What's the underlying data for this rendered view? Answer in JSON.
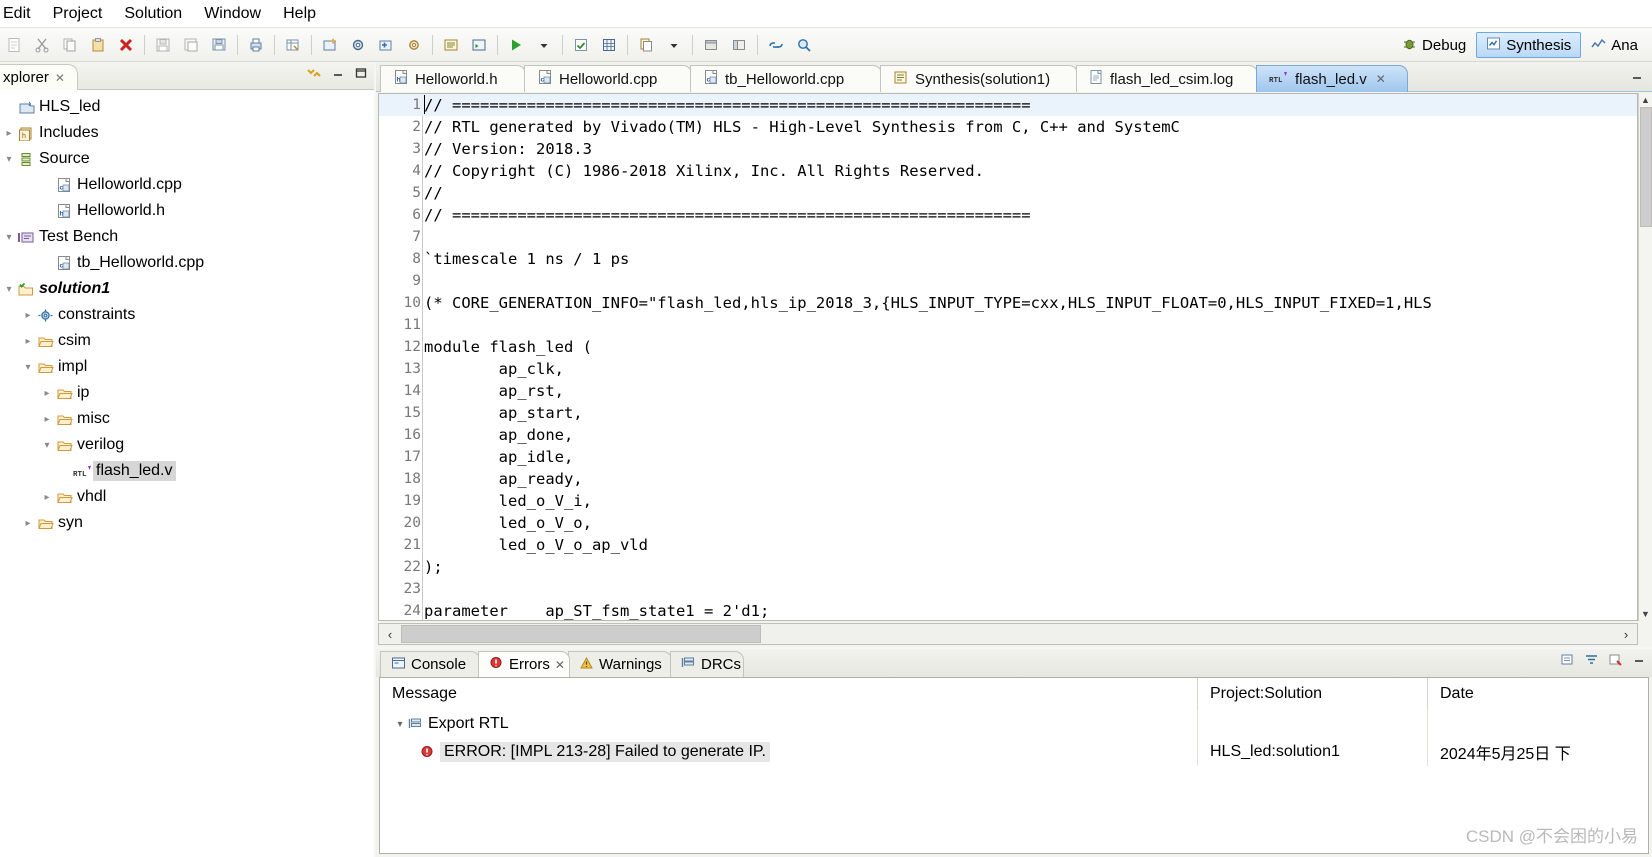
{
  "menu": {
    "items": [
      "Edit",
      "Project",
      "Solution",
      "Window",
      "Help"
    ],
    "clipped_first": "Edit"
  },
  "toolbar": {
    "icons": [
      "new-icon",
      "copy-icon",
      "paste-icon",
      "delete-icon",
      "save-icon",
      "save-as-icon",
      "save-all-icon",
      "print-icon",
      "table-icon",
      "new-project-icon",
      "settings-gear-icon",
      "add-solution-icon",
      "solution-settings-icon",
      "report-icon",
      "console-icon",
      "run-c-simulation-icon",
      "run-dropdown-icon",
      "check-icon",
      "grid-icon",
      "copy-config-icon",
      "copy-dropdown-icon",
      "window-icon",
      "window2-icon",
      "link-icon",
      "search-icon"
    ],
    "perspective_debug": "Debug",
    "perspective_synthesis": "Synthesis",
    "perspective_analysis": "Ana"
  },
  "sidebar": {
    "tab_label": "xplorer",
    "tab_close": "✕",
    "tools": [
      "collapse-all-icon",
      "minimize-icon",
      "maximize-icon"
    ],
    "tree": [
      {
        "label": "HLS_led",
        "indent": 0,
        "arrow": "",
        "icon": "project-icon",
        "selected": false,
        "bold": false
      },
      {
        "label": "Includes",
        "indent": 0,
        "arrow": "▸",
        "icon": "includes-icon",
        "selected": false,
        "bold": false
      },
      {
        "label": "Source",
        "indent": 0,
        "arrow": "▾",
        "icon": "source-icon",
        "selected": false,
        "bold": false
      },
      {
        "label": "Helloworld.cpp",
        "indent": 2,
        "arrow": "",
        "icon": "cpp-file-icon",
        "selected": false,
        "bold": false
      },
      {
        "label": "Helloworld.h",
        "indent": 2,
        "arrow": "",
        "icon": "h-file-icon",
        "selected": false,
        "bold": false
      },
      {
        "label": "Test Bench",
        "indent": 0,
        "arrow": "▾",
        "icon": "testbench-icon",
        "selected": false,
        "bold": false
      },
      {
        "label": "tb_Helloworld.cpp",
        "indent": 2,
        "arrow": "",
        "icon": "cpp-file-icon",
        "selected": false,
        "bold": false
      },
      {
        "label": "solution1",
        "indent": 0,
        "arrow": "▾",
        "icon": "solution-icon",
        "selected": false,
        "bold": true
      },
      {
        "label": "constraints",
        "indent": 1,
        "arrow": "▸",
        "icon": "constraints-icon",
        "selected": false,
        "bold": false
      },
      {
        "label": "csim",
        "indent": 1,
        "arrow": "▸",
        "icon": "folder-icon",
        "selected": false,
        "bold": false
      },
      {
        "label": "impl",
        "indent": 1,
        "arrow": "▾",
        "icon": "folder-icon",
        "selected": false,
        "bold": false
      },
      {
        "label": "ip",
        "indent": 2,
        "arrow": "▸",
        "icon": "folder-icon",
        "selected": false,
        "bold": false
      },
      {
        "label": "misc",
        "indent": 2,
        "arrow": "▸",
        "icon": "folder-icon",
        "selected": false,
        "bold": false
      },
      {
        "label": "verilog",
        "indent": 2,
        "arrow": "▾",
        "icon": "folder-icon",
        "selected": false,
        "bold": false
      },
      {
        "label": "flash_led.v",
        "indent": 3,
        "arrow": "",
        "icon": "rtl-file-icon",
        "selected": true,
        "bold": false
      },
      {
        "label": "vhdl",
        "indent": 2,
        "arrow": "▸",
        "icon": "folder-icon",
        "selected": false,
        "bold": false
      },
      {
        "label": "syn",
        "indent": 1,
        "arrow": "▸",
        "icon": "folder-icon",
        "selected": false,
        "bold": false
      }
    ]
  },
  "editor": {
    "tabs": [
      {
        "label": "Helloworld.h",
        "icon": "h-file-icon",
        "active": false,
        "closeable": false
      },
      {
        "label": "Helloworld.cpp",
        "icon": "cpp-file-icon",
        "active": false,
        "closeable": false
      },
      {
        "label": "tb_Helloworld.cpp",
        "icon": "cpp-file-icon",
        "active": false,
        "closeable": false
      },
      {
        "label": "Synthesis(solution1)",
        "icon": "report-icon",
        "active": false,
        "closeable": false
      },
      {
        "label": "flash_led_csim.log",
        "icon": "log-file-icon",
        "active": false,
        "closeable": false
      },
      {
        "label": "flash_led.v",
        "icon": "rtl-file-icon",
        "active": true,
        "closeable": true
      }
    ],
    "tab_close": "✕",
    "minimize": "▭",
    "lines": [
      {
        "n": 1,
        "text": "// =============================================================="
      },
      {
        "n": 2,
        "text": "// RTL generated by Vivado(TM) HLS - High-Level Synthesis from C, C++ and SystemC"
      },
      {
        "n": 3,
        "text": "// Version: 2018.3"
      },
      {
        "n": 4,
        "text": "// Copyright (C) 1986-2018 Xilinx, Inc. All Rights Reserved."
      },
      {
        "n": 5,
        "text": "//"
      },
      {
        "n": 6,
        "text": "// =============================================================="
      },
      {
        "n": 7,
        "text": ""
      },
      {
        "n": 8,
        "text": "`timescale 1 ns / 1 ps"
      },
      {
        "n": 9,
        "text": ""
      },
      {
        "n": 10,
        "text": "(* CORE_GENERATION_INFO=\"flash_led,hls_ip_2018_3,{HLS_INPUT_TYPE=cxx,HLS_INPUT_FLOAT=0,HLS_INPUT_FIXED=1,HLS"
      },
      {
        "n": 11,
        "text": ""
      },
      {
        "n": 12,
        "text": "module flash_led ("
      },
      {
        "n": 13,
        "text": "        ap_clk,"
      },
      {
        "n": 14,
        "text": "        ap_rst,"
      },
      {
        "n": 15,
        "text": "        ap_start,"
      },
      {
        "n": 16,
        "text": "        ap_done,"
      },
      {
        "n": 17,
        "text": "        ap_idle,"
      },
      {
        "n": 18,
        "text": "        ap_ready,"
      },
      {
        "n": 19,
        "text": "        led_o_V_i,"
      },
      {
        "n": 20,
        "text": "        led_o_V_o,"
      },
      {
        "n": 21,
        "text": "        led_o_V_o_ap_vld"
      },
      {
        "n": 22,
        "text": ");"
      },
      {
        "n": 23,
        "text": ""
      },
      {
        "n": 24,
        "text": "parameter    ap_ST_fsm_state1 = 2'd1;"
      }
    ],
    "current_line": 1,
    "scroll_left_arrow": "‹",
    "scroll_right_arrow": "›",
    "scroll_up_arrow": "▲",
    "scroll_down_arrow": "▼"
  },
  "bottom_panel": {
    "tabs": [
      {
        "label": "Console",
        "icon": "console-icon",
        "active": false,
        "closeable": false
      },
      {
        "label": "Errors",
        "icon": "error-icon",
        "active": true,
        "closeable": true
      },
      {
        "label": "Warnings",
        "icon": "warning-icon",
        "active": false,
        "closeable": false
      },
      {
        "label": "DRCs",
        "icon": "drc-icon",
        "active": false,
        "closeable": false
      }
    ],
    "tab_close": "✕",
    "tools": [
      "export-icon",
      "filter-icon",
      "clear-icon",
      "minimize-icon"
    ],
    "columns": [
      "Message",
      "Project:Solution",
      "Date"
    ],
    "rows": [
      {
        "type": "group",
        "toggle": "▾",
        "icon": "export-rtl-icon",
        "message": "Export RTL",
        "project": "",
        "date": ""
      },
      {
        "type": "error",
        "toggle": "",
        "icon": "error-icon",
        "message": "ERROR: [IMPL 213-28] Failed to generate IP.",
        "project": "HLS_led:solution1",
        "date": "2024年5月25日 下"
      }
    ]
  },
  "watermark": "CSDN @不会困的小易"
}
